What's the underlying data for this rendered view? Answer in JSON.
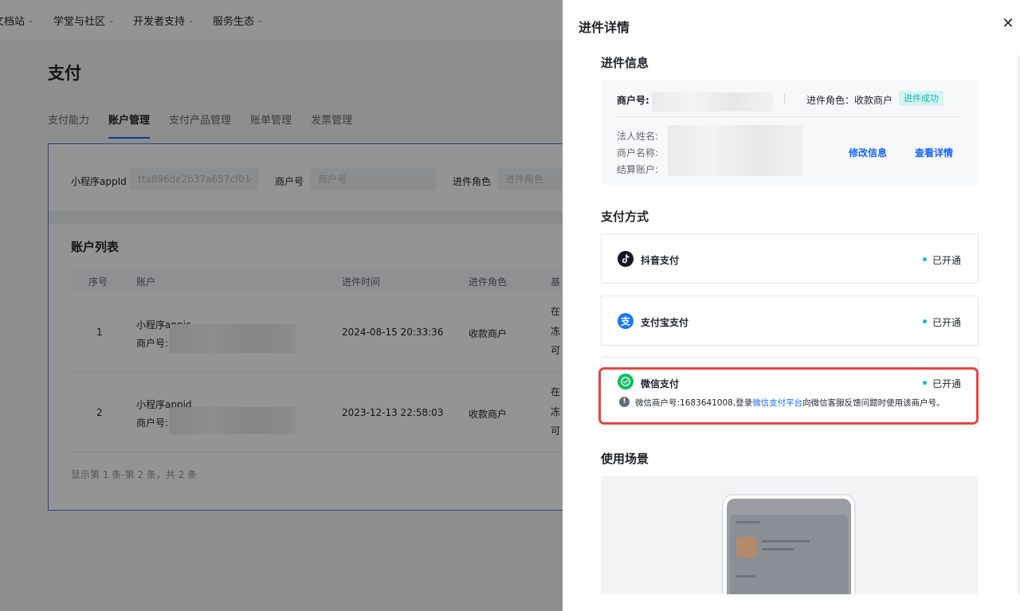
{
  "topnav": {
    "items": [
      {
        "label": "文档站"
      },
      {
        "label": "学堂与社区"
      },
      {
        "label": "开发者支持"
      },
      {
        "label": "服务生态"
      }
    ]
  },
  "page": {
    "title": "支付",
    "tabs": [
      {
        "label": "支付能力"
      },
      {
        "label": "账户管理"
      },
      {
        "label": "支付产品管理"
      },
      {
        "label": "账单管理"
      },
      {
        "label": "发票管理"
      }
    ],
    "active_tab": "账户管理"
  },
  "filters": {
    "appid_label": "小程序appId",
    "appid_value": "tta896de2b37a657cf01",
    "merchant_label": "商户号",
    "merchant_placeholder": "商户号",
    "role_label": "进件角色",
    "role_placeholder": "进件角色"
  },
  "account_list": {
    "title": "账户列表",
    "columns": [
      "序号",
      "账户",
      "进件时间",
      "进件角色",
      "基"
    ],
    "rows": [
      {
        "index": "1",
        "appid_line": "小程序appic",
        "merchant_line": "商户号:",
        "time": "2024-08-15 20:33:36",
        "role": "收款商户",
        "status_lines": [
          "在",
          "冻",
          "可"
        ]
      },
      {
        "index": "2",
        "appid_line": "小程序appid",
        "merchant_line": "商户号:",
        "time": "2023-12-13 22:58:03",
        "role": "收款商户",
        "status_lines": [
          "在",
          "冻",
          "可"
        ]
      }
    ],
    "footer": "显示第 1 条-第 2 条，共 2 条"
  },
  "drawer": {
    "title": "进件详情",
    "close_label": "✕",
    "info_section": {
      "title": "进件信息",
      "merchant_no_label": "商户号:",
      "role_text": "进件角色：收款商户",
      "badge": "进件成功",
      "legal_name_label": "法人姓名:",
      "merchant_name_label": "商户名称:",
      "settle_account_label": "结算账户:",
      "edit_link": "修改信息",
      "detail_link": "查看详情"
    },
    "payment_section": {
      "title": "支付方式",
      "methods": [
        {
          "name": "抖音支付",
          "status": "已开通",
          "icon": "douyin-icon",
          "color": "#161823"
        },
        {
          "name": "支付宝支付",
          "status": "已开通",
          "icon": "alipay-icon",
          "color": "#1677ff"
        },
        {
          "name": "微信支付",
          "status": "已开通",
          "icon": "wechat-pay-icon",
          "color": "#07c160",
          "note_prefix": "微信商户号:1683641008,登录",
          "note_link": "微信支付平台",
          "note_suffix": "向微信客服反馈问题时使用该商户号。"
        }
      ]
    },
    "scene_section": {
      "title": "使用场景"
    }
  },
  "colors": {
    "accent": "#1664ff",
    "success": "#14c0b5",
    "highlight": "#e84545"
  }
}
